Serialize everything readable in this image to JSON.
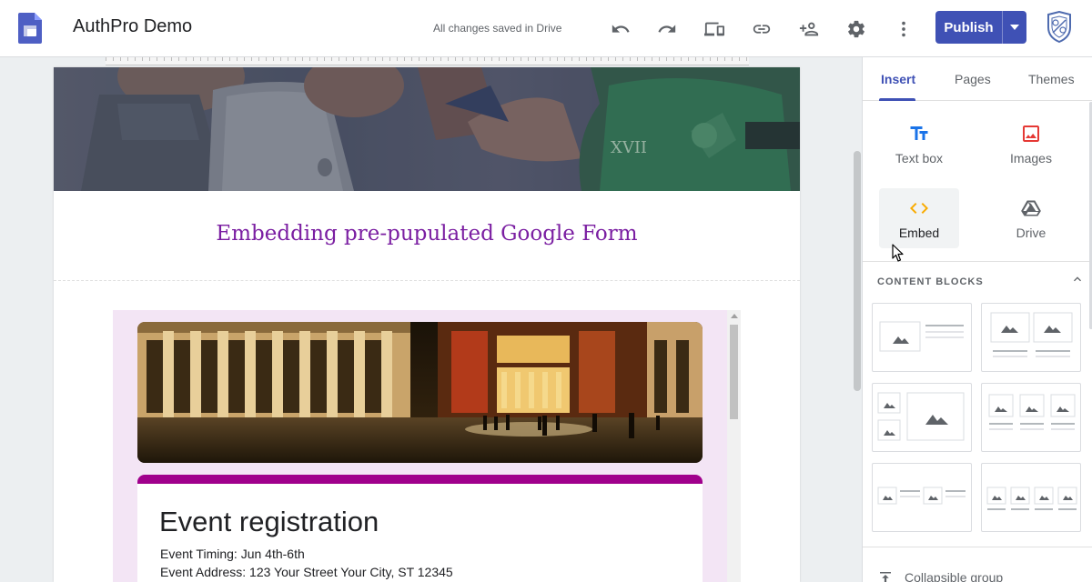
{
  "app": {
    "title": "AuthPro Demo",
    "save_status": "All changes saved in Drive"
  },
  "toolbar": {
    "icons": [
      "undo-icon",
      "redo-icon",
      "preview-device-icon",
      "link-icon",
      "share-person-add-icon",
      "settings-gear-icon",
      "more-vert-icon"
    ],
    "publish_label": "Publish"
  },
  "colors": {
    "accent": "#3f51b5",
    "heading": "#7b1fa2",
    "form_theme": "#a0008c",
    "form_background": "#f3e5f5"
  },
  "page": {
    "section_heading": "Embedding pre-pupulated Google Form",
    "form": {
      "title": "Event registration",
      "lines": [
        "Event Timing: Jun 4th-6th",
        "Event Address: 123 Your Street Your City, ST 12345"
      ]
    }
  },
  "sidepanel": {
    "tabs": [
      {
        "label": "Insert",
        "active": true
      },
      {
        "label": "Pages",
        "active": false
      },
      {
        "label": "Themes",
        "active": false
      }
    ],
    "insert_items": [
      {
        "label": "Text box",
        "icon": "text-box-icon"
      },
      {
        "label": "Images",
        "icon": "image-icon"
      },
      {
        "label": "Embed",
        "icon": "embed-code-icon"
      },
      {
        "label": "Drive",
        "icon": "drive-icon"
      }
    ],
    "content_blocks_heading": "CONTENT BLOCKS",
    "collapsible_label": "Collapsible group"
  }
}
